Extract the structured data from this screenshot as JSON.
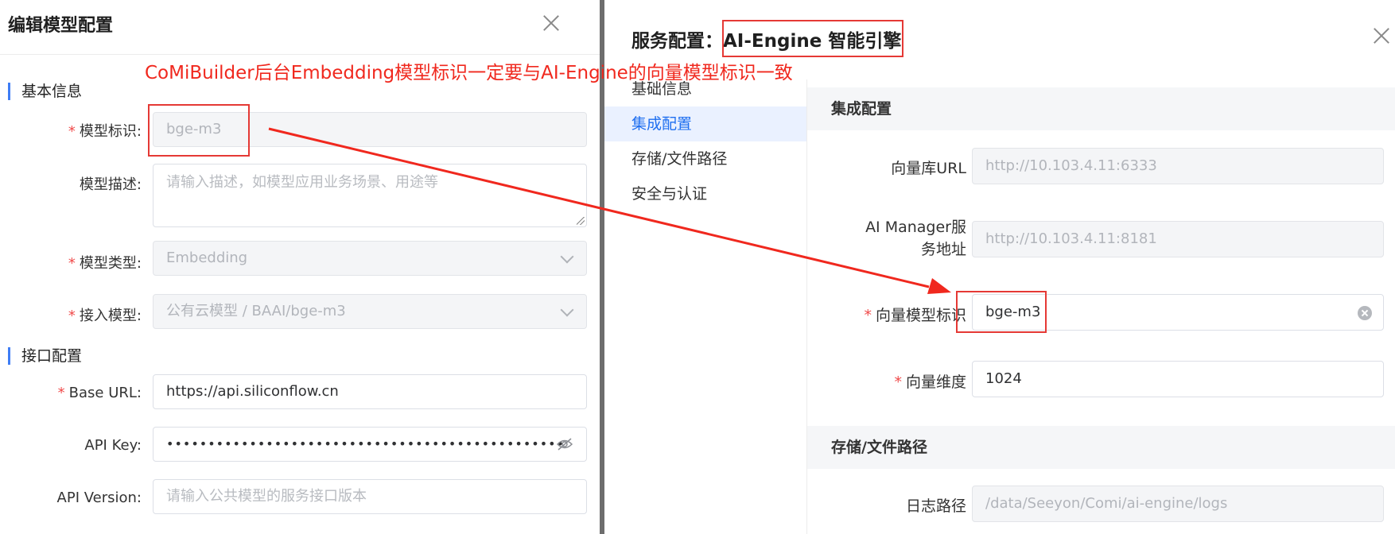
{
  "left_dialog": {
    "title": "编辑模型配置",
    "sections": {
      "basic": "基本信息",
      "interface": "接口配置"
    },
    "fields": {
      "model_id": {
        "label": "模型标识",
        "value": "bge-m3"
      },
      "model_desc": {
        "label": "模型描述",
        "placeholder": "请输入描述，如模型应用业务场景、用途等"
      },
      "model_type": {
        "label": "模型类型",
        "value": "Embedding"
      },
      "access_model": {
        "label": "接入模型",
        "value": "公有云模型 / BAAI/bge-m3"
      },
      "base_url": {
        "label": "Base URL",
        "value": "https://api.siliconflow.cn"
      },
      "api_key": {
        "label": "API Key",
        "value": "••••••••••••••••••••••••••••••••••••••••••••••••"
      },
      "api_version": {
        "label": "API Version",
        "placeholder": "请输入公共模型的服务接口版本"
      }
    },
    "colon": ":"
  },
  "right_dialog": {
    "title_prefix": "服务配置：",
    "title_name": "AI-Engine 智能引擎",
    "nav": [
      "基础信息",
      "集成配置",
      "存储/文件路径",
      "安全与认证"
    ],
    "sections": {
      "integration": "集成配置",
      "storage": "存储/文件路径"
    },
    "fields": {
      "vector_db_url": {
        "label": "向量库URL",
        "value": "http://10.103.4.11:6333"
      },
      "ai_manager_line1": "AI Manager服",
      "ai_manager_line2": "务地址",
      "ai_manager_value": "http://10.103.4.11:8181",
      "vector_model_id": {
        "label": "向量模型标识",
        "value": "bge-m3"
      },
      "vector_dim": {
        "label": "向量维度",
        "value": "1024"
      },
      "log_path": {
        "label": "日志路径",
        "value": "/data/Seeyon/Comi/ai-engine/logs"
      }
    }
  },
  "annotation": {
    "text": "CoMiBuilder后台Embedding模型标识一定要与AI-Engine的向量模型标识一致",
    "color": "#f0281e"
  },
  "colors": {
    "accent": "#1f6ff0",
    "required": "#f04a4a",
    "annotation_red": "#e53935"
  }
}
